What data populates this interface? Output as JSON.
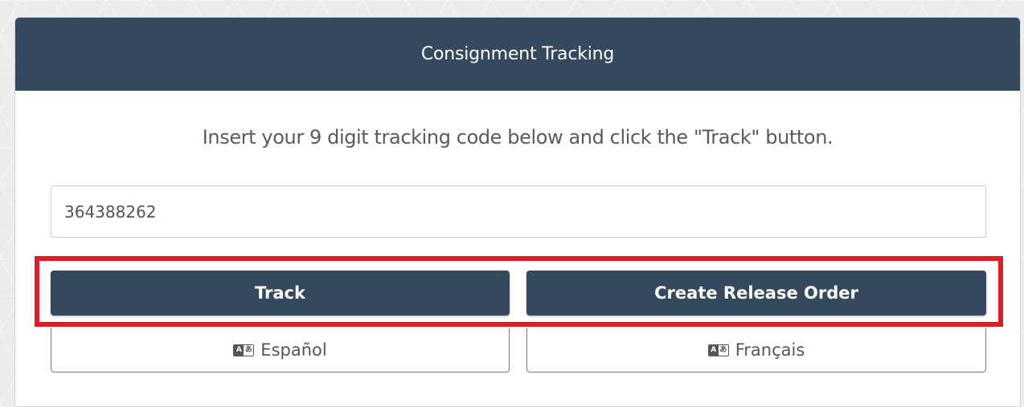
{
  "header": {
    "title": "Consignment Tracking"
  },
  "instruction": "Insert your 9 digit tracking code below and click the \"Track\" button.",
  "tracking_input": {
    "value": "364388262",
    "placeholder": ""
  },
  "buttons": {
    "track_label": "Track",
    "release_order_label": "Create Release Order",
    "spanish_label": "Español",
    "french_label": "Français"
  },
  "icons": {
    "language": "language-icon"
  },
  "colors": {
    "header_bg": "#34495e",
    "primary_button": "#34495e",
    "highlight": "#e31b23"
  }
}
